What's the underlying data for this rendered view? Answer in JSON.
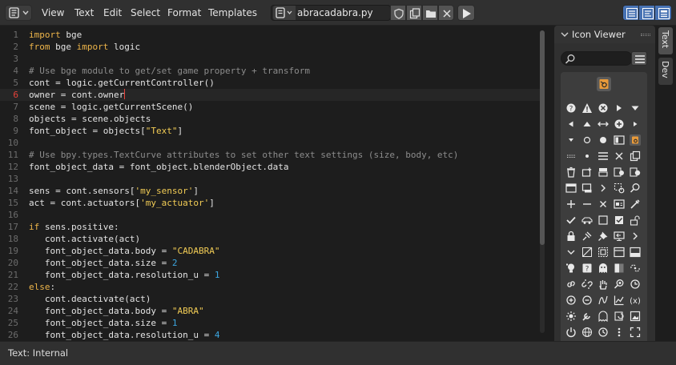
{
  "header": {
    "menus": [
      "View",
      "Text",
      "Edit",
      "Select",
      "Format",
      "Templates"
    ],
    "editor_type_icon": "text-editor-icon",
    "datablock_icon": "text-datablock-icon",
    "file_name": "abracadabra.py",
    "buttons": [
      "fake-user-icon",
      "duplicate-icon",
      "open-folder-icon",
      "close-icon"
    ],
    "run_icon": "play-icon",
    "view_toggles": [
      "line-numbers-icon",
      "word-wrap-icon",
      "syntax-highlight-icon"
    ],
    "accent_color": "#4772b3"
  },
  "editor": {
    "current_line": 6,
    "lines": [
      {
        "n": "1",
        "tokens": [
          [
            "kw",
            "import"
          ],
          [
            "",
            " bge"
          ]
        ]
      },
      {
        "n": "2",
        "tokens": [
          [
            "kw",
            "from"
          ],
          [
            "",
            " bge "
          ],
          [
            "kw",
            "import"
          ],
          [
            "",
            " logic"
          ]
        ]
      },
      {
        "n": "3",
        "tokens": []
      },
      {
        "n": "4",
        "tokens": [
          [
            "cm",
            "# Use bge module to get/set game property + transform"
          ]
        ]
      },
      {
        "n": "5",
        "tokens": [
          [
            "",
            "cont "
          ],
          [
            "sy",
            "="
          ],
          [
            "",
            " logic"
          ],
          [
            "sy",
            "."
          ],
          [
            "",
            "getCurrentController"
          ],
          [
            "sy",
            "()"
          ]
        ]
      },
      {
        "n": "6",
        "tokens": [
          [
            "",
            "owner "
          ],
          [
            "sy",
            "="
          ],
          [
            "",
            " cont"
          ],
          [
            "sy",
            "."
          ],
          [
            "",
            "owner"
          ]
        ]
      },
      {
        "n": "7",
        "tokens": [
          [
            "",
            "scene "
          ],
          [
            "sy",
            "="
          ],
          [
            "",
            " logic"
          ],
          [
            "sy",
            "."
          ],
          [
            "",
            "getCurrentScene"
          ],
          [
            "sy",
            "()"
          ]
        ]
      },
      {
        "n": "8",
        "tokens": [
          [
            "",
            "objects "
          ],
          [
            "sy",
            "="
          ],
          [
            "",
            " scene"
          ],
          [
            "sy",
            "."
          ],
          [
            "",
            "objects"
          ]
        ]
      },
      {
        "n": "9",
        "tokens": [
          [
            "",
            "font_object "
          ],
          [
            "sy",
            "="
          ],
          [
            "",
            " objects"
          ],
          [
            "sy",
            "["
          ],
          [
            "st",
            "\"Text\""
          ],
          [
            "sy",
            "]"
          ]
        ]
      },
      {
        "n": "10",
        "tokens": []
      },
      {
        "n": "11",
        "tokens": [
          [
            "cm",
            "# Use bpy.types.TextCurve attributes to set other text settings (size, body, etc)"
          ]
        ]
      },
      {
        "n": "12",
        "tokens": [
          [
            "",
            "font_object_data "
          ],
          [
            "sy",
            "="
          ],
          [
            "",
            " font_object"
          ],
          [
            "sy",
            "."
          ],
          [
            "",
            "blenderObject"
          ],
          [
            "sy",
            "."
          ],
          [
            "",
            "data"
          ]
        ]
      },
      {
        "n": "13",
        "tokens": []
      },
      {
        "n": "14",
        "tokens": [
          [
            "",
            "sens "
          ],
          [
            "sy",
            "="
          ],
          [
            "",
            " cont"
          ],
          [
            "sy",
            "."
          ],
          [
            "",
            "sensors"
          ],
          [
            "sy",
            "["
          ],
          [
            "st",
            "'my_sensor'"
          ],
          [
            "sy",
            "]"
          ]
        ]
      },
      {
        "n": "15",
        "tokens": [
          [
            "",
            "act "
          ],
          [
            "sy",
            "="
          ],
          [
            "",
            " cont"
          ],
          [
            "sy",
            "."
          ],
          [
            "",
            "actuators"
          ],
          [
            "sy",
            "["
          ],
          [
            "st",
            "'my_actuator'"
          ],
          [
            "sy",
            "]"
          ]
        ]
      },
      {
        "n": "16",
        "tokens": []
      },
      {
        "n": "17",
        "tokens": [
          [
            "kw",
            "if"
          ],
          [
            "",
            " sens"
          ],
          [
            "sy",
            "."
          ],
          [
            "",
            "positive"
          ],
          [
            "sy",
            ":"
          ]
        ]
      },
      {
        "n": "18",
        "tokens": [
          [
            "",
            "   cont"
          ],
          [
            "sy",
            "."
          ],
          [
            "",
            "activate"
          ],
          [
            "sy",
            "("
          ],
          [
            "",
            "act"
          ],
          [
            "sy",
            ")"
          ]
        ]
      },
      {
        "n": "19",
        "tokens": [
          [
            "",
            "   font_object_data"
          ],
          [
            "sy",
            "."
          ],
          [
            "",
            "body "
          ],
          [
            "sy",
            "="
          ],
          [
            "",
            " "
          ],
          [
            "st",
            "\"CADABRA\""
          ]
        ]
      },
      {
        "n": "20",
        "tokens": [
          [
            "",
            "   font_object_data"
          ],
          [
            "sy",
            "."
          ],
          [
            "",
            "size "
          ],
          [
            "sy",
            "="
          ],
          [
            "",
            " "
          ],
          [
            "nu",
            "2"
          ]
        ]
      },
      {
        "n": "21",
        "tokens": [
          [
            "",
            "   font_object_data"
          ],
          [
            "sy",
            "."
          ],
          [
            "",
            "resolution_u "
          ],
          [
            "sy",
            "="
          ],
          [
            "",
            " "
          ],
          [
            "nu",
            "1"
          ]
        ]
      },
      {
        "n": "22",
        "tokens": [
          [
            "kw",
            "else"
          ],
          [
            "sy",
            ":"
          ]
        ]
      },
      {
        "n": "23",
        "tokens": [
          [
            "",
            "   cont"
          ],
          [
            "sy",
            "."
          ],
          [
            "",
            "deactivate"
          ],
          [
            "sy",
            "("
          ],
          [
            "",
            "act"
          ],
          [
            "sy",
            ")"
          ]
        ]
      },
      {
        "n": "24",
        "tokens": [
          [
            "",
            "   font_object_data"
          ],
          [
            "sy",
            "."
          ],
          [
            "",
            "body "
          ],
          [
            "sy",
            "="
          ],
          [
            "",
            " "
          ],
          [
            "st",
            "\"ABRA\""
          ]
        ]
      },
      {
        "n": "25",
        "tokens": [
          [
            "",
            "   font_object_data"
          ],
          [
            "sy",
            "."
          ],
          [
            "",
            "size "
          ],
          [
            "sy",
            "="
          ],
          [
            "",
            " "
          ],
          [
            "nu",
            "1"
          ]
        ]
      },
      {
        "n": "26",
        "tokens": [
          [
            "",
            "   font_object_data"
          ],
          [
            "sy",
            "."
          ],
          [
            "",
            "resolution_u "
          ],
          [
            "sy",
            "="
          ],
          [
            "",
            " "
          ],
          [
            "nu",
            "4"
          ]
        ]
      }
    ],
    "colors": {
      "keyword": "#eeb54a",
      "string": "#f2cc55",
      "number": "#3ca6e0",
      "comment": "#8c8c8c",
      "current_line_number": "#e8423a"
    }
  },
  "sidebar": {
    "panel_title": "Icon Viewer",
    "search_placeholder": "",
    "tabs": [
      "Text",
      "Dev"
    ],
    "active_tab": "Text",
    "selected_icon": "blender-file-icon",
    "icons": [
      "question-icon",
      "error-icon",
      "cancel-icon",
      "play-right-icon",
      "triangle-down-icon",
      "triangle-left-icon",
      "triangle-up-icon",
      "arrows-lr-icon",
      "add-circle-icon",
      "triangle-right-small-icon",
      "down-arrow-icon",
      "dot-outline-icon",
      "dot-icon",
      "list-panel-icon",
      "file-blend-icon",
      "grip-icon",
      "small-dot-icon",
      "menu-lines-icon",
      "x-icon",
      "duplicate-icon",
      "trash-icon",
      "add-folder-icon",
      "file-new-icon",
      "toggle-off-icon",
      "toggle-on-icon",
      "window-icon",
      "workspace-icon",
      "chevron-right-icon",
      "select-region-icon",
      "zoom-icon",
      "plus-icon",
      "minus-icon",
      "close-small-icon",
      "id-card-icon",
      "eyedropper-icon",
      "checkmark-icon",
      "car-icon",
      "checkbox-off-icon",
      "checkbox-on-icon",
      "unlock-icon",
      "lock-icon",
      "pin-off-icon",
      "pin-icon",
      "screen-back-icon",
      "chevron-right2-icon",
      "chevron-down-icon",
      "fullscreen-enter-icon",
      "fullscreen-exit-icon",
      "split-view-icon",
      "panel-icon",
      "lightbulb-icon",
      "help-icon",
      "ghost-icon",
      "color-icon",
      "linked-icon",
      "link-icon",
      "unlink-icon",
      "hand-icon",
      "zoom-all-icon",
      "zoom-prev-icon",
      "zoom-in-icon",
      "zoom-out-icon",
      "driver-icon",
      "graph-icon",
      "expression-icon",
      "sun-icon",
      "wrench-icon",
      "ghost-outline-icon",
      "recover-icon",
      "image-plane-icon",
      "power-icon",
      "globe-icon",
      "history-icon",
      "dots-vertical-icon",
      "fullscreen-icon"
    ]
  },
  "footer": {
    "status": "Text: Internal"
  }
}
